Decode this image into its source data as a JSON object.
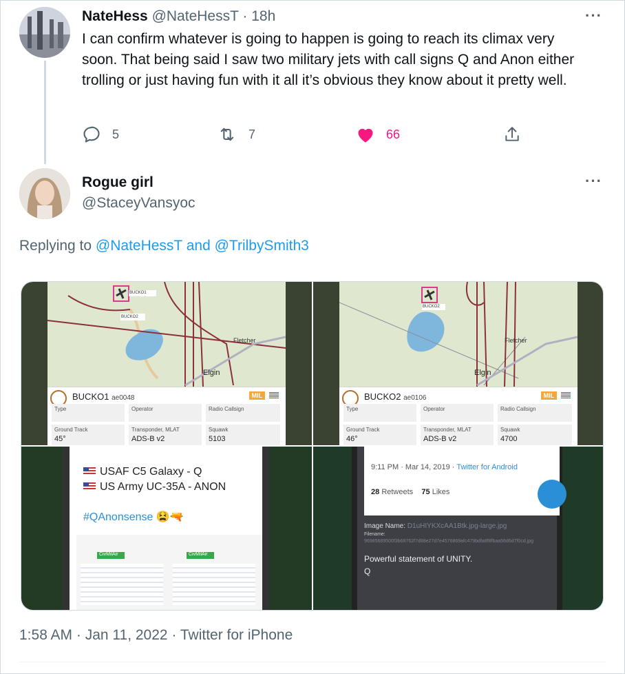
{
  "parent_tweet": {
    "display_name": "NateHess",
    "handle": "@NateHessT",
    "separator": "·",
    "time": "18h",
    "text": "I can confirm whatever is going to happen is going to reach its climax very soon.  That being said I saw two military jets with call signs Q and Anon either trolling or just having fun with it all it’s obvious they know about it pretty well.",
    "replies": "5",
    "retweets": "7",
    "likes": "66",
    "liked": true,
    "icons": {
      "reply": "reply-icon",
      "retweet": "retweet-icon",
      "like": "heart-icon",
      "share": "share-icon",
      "more": "more-icon"
    }
  },
  "reply_tweet": {
    "display_name": "Rogue girl",
    "handle": "@StaceyVansyoc",
    "replying_prefix": "Replying to",
    "replying_to": "@NateHessT and @TrilbySmith3",
    "timestamp": "1:58 AM · Jan 11, 2022 · Twitter for iPhone"
  },
  "media": {
    "map1": {
      "callsign": "BUCKO1",
      "hex": "ae0048",
      "badge": "MIL",
      "label_a": "BUCKO1",
      "label_b": "BUCKO2",
      "place_1": "Fletcher",
      "place_2": "Elgin",
      "fields": [
        {
          "label": "Type",
          "value": ""
        },
        {
          "label": "Operator",
          "value": ""
        },
        {
          "label": "Radio Callsign",
          "value": ""
        },
        {
          "label": "Ground Track",
          "value": "45°"
        },
        {
          "label": "Transponder, MLAT",
          "value": "ADS-B v2"
        },
        {
          "label": "Squawk",
          "value": "5103"
        }
      ]
    },
    "map2": {
      "callsign": "BUCKO2",
      "hex": "ae0106",
      "badge": "MIL",
      "label_b": "BUCKO2",
      "place_1": "Fletcher",
      "place_2": "Elgin",
      "fields": [
        {
          "label": "Type",
          "value": ""
        },
        {
          "label": "Operator",
          "value": ""
        },
        {
          "label": "Radio Callsign",
          "value": ""
        },
        {
          "label": "Ground Track",
          "value": "46°"
        },
        {
          "label": "Transponder, MLAT",
          "value": "ADS-B v2"
        },
        {
          "label": "Squawk",
          "value": "4700"
        }
      ]
    },
    "phone_post": {
      "line_1": "USAF C5 Galaxy - Q",
      "line_2": "US Army UC-35A - ANON",
      "hashtag": "#QAnonsense",
      "emoji": "😫🔫",
      "site_logo": "CivMilAir"
    },
    "phone_tweet": {
      "meta_time": "9:11 PM · Mar 14, 2019 ·",
      "meta_client": "Twitter for Android",
      "retweets_count": "28",
      "retweets_label": "Retweets",
      "likes_count": "75",
      "likes_label": "Likes",
      "image_name_label": "Image Name:",
      "image_name": "D1uHIYKXcAA1Btk.jpg-large.jpg",
      "filename_label": "Filename:",
      "filename_hash": "96985689500f3b68762f7d88e27d7e4576869afc479bdfa8f8fbaa56d6d7f0cd.jpg",
      "statement": "Powerful statement of UNITY.",
      "q": "Q"
    }
  },
  "colors": {
    "text": "#0f1419",
    "muted": "#536471",
    "link": "#1d9bf0",
    "like": "#f91880",
    "border": "#cfd9de"
  }
}
